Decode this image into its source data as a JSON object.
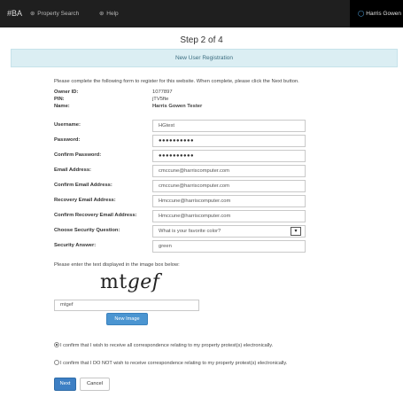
{
  "navbar": {
    "brand": "#BA",
    "links": [
      {
        "icon": "search-icon",
        "glyph": "⊛",
        "label": "Property Search"
      },
      {
        "icon": "help-icon",
        "glyph": "⊛",
        "label": "Help"
      }
    ],
    "user": {
      "icon": "user-icon",
      "glyph": "◯",
      "label": "Harris Gowen"
    }
  },
  "step": "Step 2 of 4",
  "banner": "New User Registration",
  "intro": "Please complete the following form to register for this website. When complete, please click the Next button.",
  "info": [
    {
      "label": "Owner ID:",
      "value": "1077897"
    },
    {
      "label": "PIN:",
      "value": "jTV5fte"
    },
    {
      "label": "Name:",
      "value": "Harris Gowen Tester"
    }
  ],
  "form": {
    "username": {
      "label": "Username:",
      "value": "HGtest"
    },
    "password": {
      "label": "Password:",
      "value": "●●●●●●●●●●"
    },
    "confirm_password": {
      "label": "Confirm Password:",
      "value": "●●●●●●●●●●"
    },
    "email": {
      "label": "Email Address:",
      "value": "cmccune@harriscomputer.com"
    },
    "confirm_email": {
      "label": "Confirm Email Address:",
      "value": "cmccune@harriscomputer.com"
    },
    "recovery_email": {
      "label": "Recovery Email Address:",
      "value": "Hmccune@harriscomputer.com"
    },
    "confirm_recovery_email": {
      "label": "Confirm Recovery Email Address:",
      "value": "Hmccune@harriscomputer.com"
    },
    "security_question": {
      "label": "Choose Security Question:",
      "value": "What is your favorite color?",
      "arrow": "▾"
    },
    "security_answer": {
      "label": "Security Answer:",
      "value": "green"
    }
  },
  "captcha": {
    "prompt": "Please enter the text displayed in the image box below:",
    "image_text_a": "mt",
    "image_text_b": "gef",
    "input_value": "mtgef",
    "new_image_label": "New Image"
  },
  "consent": {
    "option_yes": "I confirm that I wish to receive all correspondence relating to my property protest(s) electronically.",
    "option_no": "I confirm that I DO NOT wish to receive correspondence relating to my property protest(s) electronically.",
    "selected": "yes"
  },
  "buttons": {
    "next": "Next",
    "cancel": "Cancel"
  },
  "colors": {
    "navbar": "#1f1f1f",
    "banner": "#dbeef3",
    "primary": "#3d7fc4"
  }
}
